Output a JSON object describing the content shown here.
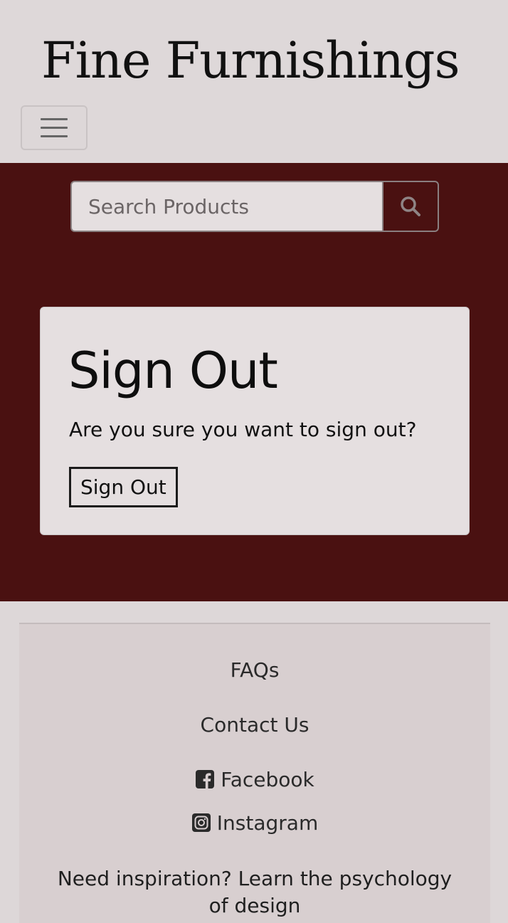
{
  "header": {
    "brand": "Fine Furnishings",
    "menu_toggle_icon": "hamburger-menu-icon"
  },
  "search": {
    "placeholder": "Search Products",
    "button_icon": "search-icon"
  },
  "signout_card": {
    "title": "Sign Out",
    "message": "Are you sure you want to sign out?",
    "button_label": "Sign Out"
  },
  "footer": {
    "links": [
      {
        "label": "FAQs"
      },
      {
        "label": "Contact Us"
      },
      {
        "label": "Facebook",
        "icon": "facebook-icon"
      },
      {
        "label": "Instagram",
        "icon": "instagram-icon"
      }
    ],
    "inspiration_text": "Need inspiration? Learn the psychology of design"
  },
  "colors": {
    "header_bg": "#ded8d9",
    "main_bg": "#4a1111",
    "card_bg": "#e5dfe0",
    "footer_bg": "#d8cfd0"
  }
}
